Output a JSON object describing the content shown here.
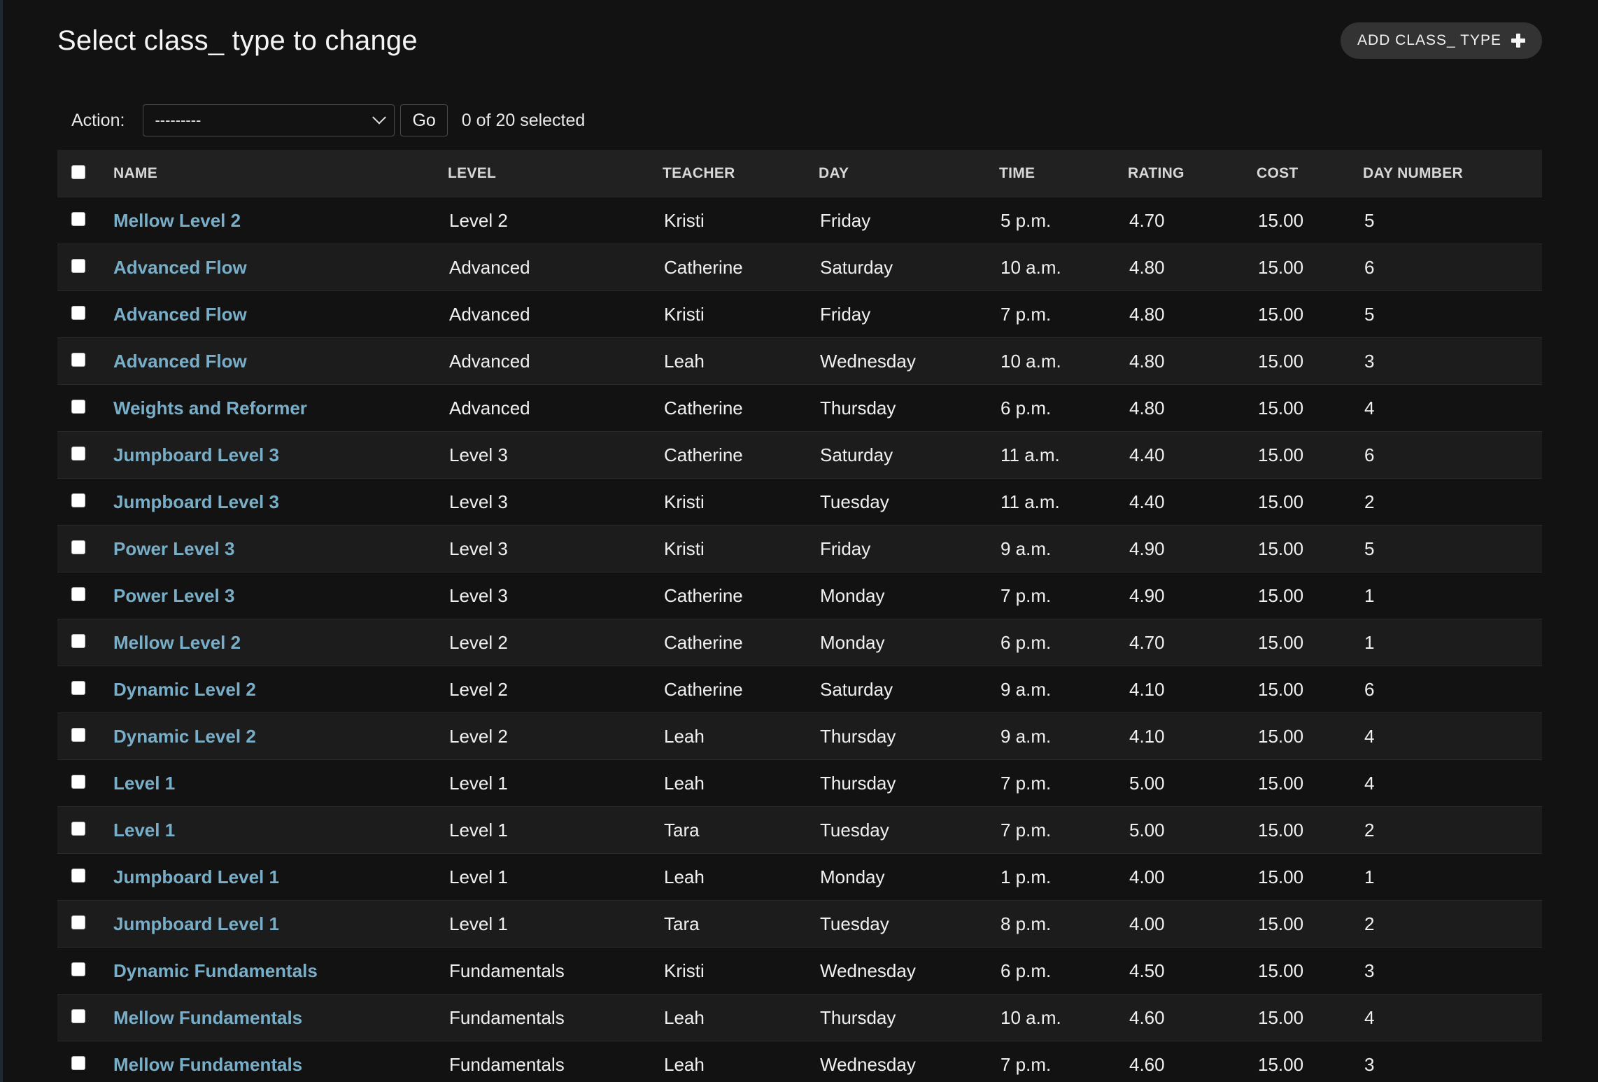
{
  "page": {
    "title": "Select class_ type to change",
    "add_button_label": "ADD CLASS_ TYPE"
  },
  "actions": {
    "label": "Action:",
    "select_value": "---------",
    "go_label": "Go",
    "selection_counter": "0 of 20 selected"
  },
  "table": {
    "columns": [
      "NAME",
      "LEVEL",
      "TEACHER",
      "DAY",
      "TIME",
      "RATING",
      "COST",
      "DAY NUMBER"
    ],
    "rows": [
      {
        "name": "Mellow Level 2",
        "level": "Level 2",
        "teacher": "Kristi",
        "day": "Friday",
        "time": "5 p.m.",
        "rating": "4.70",
        "cost": "15.00",
        "day_number": "5"
      },
      {
        "name": "Advanced Flow",
        "level": "Advanced",
        "teacher": "Catherine",
        "day": "Saturday",
        "time": "10 a.m.",
        "rating": "4.80",
        "cost": "15.00",
        "day_number": "6"
      },
      {
        "name": "Advanced Flow",
        "level": "Advanced",
        "teacher": "Kristi",
        "day": "Friday",
        "time": "7 p.m.",
        "rating": "4.80",
        "cost": "15.00",
        "day_number": "5"
      },
      {
        "name": "Advanced Flow",
        "level": "Advanced",
        "teacher": "Leah",
        "day": "Wednesday",
        "time": "10 a.m.",
        "rating": "4.80",
        "cost": "15.00",
        "day_number": "3"
      },
      {
        "name": "Weights and Reformer",
        "level": "Advanced",
        "teacher": "Catherine",
        "day": "Thursday",
        "time": "6 p.m.",
        "rating": "4.80",
        "cost": "15.00",
        "day_number": "4"
      },
      {
        "name": "Jumpboard Level 3",
        "level": "Level 3",
        "teacher": "Catherine",
        "day": "Saturday",
        "time": "11 a.m.",
        "rating": "4.40",
        "cost": "15.00",
        "day_number": "6"
      },
      {
        "name": "Jumpboard Level 3",
        "level": "Level 3",
        "teacher": "Kristi",
        "day": "Tuesday",
        "time": "11 a.m.",
        "rating": "4.40",
        "cost": "15.00",
        "day_number": "2"
      },
      {
        "name": "Power Level 3",
        "level": "Level 3",
        "teacher": "Kristi",
        "day": "Friday",
        "time": "9 a.m.",
        "rating": "4.90",
        "cost": "15.00",
        "day_number": "5"
      },
      {
        "name": "Power Level 3",
        "level": "Level 3",
        "teacher": "Catherine",
        "day": "Monday",
        "time": "7 p.m.",
        "rating": "4.90",
        "cost": "15.00",
        "day_number": "1"
      },
      {
        "name": "Mellow Level 2",
        "level": "Level 2",
        "teacher": "Catherine",
        "day": "Monday",
        "time": "6 p.m.",
        "rating": "4.70",
        "cost": "15.00",
        "day_number": "1"
      },
      {
        "name": "Dynamic Level 2",
        "level": "Level 2",
        "teacher": "Catherine",
        "day": "Saturday",
        "time": "9 a.m.",
        "rating": "4.10",
        "cost": "15.00",
        "day_number": "6"
      },
      {
        "name": "Dynamic Level 2",
        "level": "Level 2",
        "teacher": "Leah",
        "day": "Thursday",
        "time": "9 a.m.",
        "rating": "4.10",
        "cost": "15.00",
        "day_number": "4"
      },
      {
        "name": "Level 1",
        "level": "Level 1",
        "teacher": "Leah",
        "day": "Thursday",
        "time": "7 p.m.",
        "rating": "5.00",
        "cost": "15.00",
        "day_number": "4"
      },
      {
        "name": "Level 1",
        "level": "Level 1",
        "teacher": "Tara",
        "day": "Tuesday",
        "time": "7 p.m.",
        "rating": "5.00",
        "cost": "15.00",
        "day_number": "2"
      },
      {
        "name": "Jumpboard Level 1",
        "level": "Level 1",
        "teacher": "Leah",
        "day": "Monday",
        "time": "1 p.m.",
        "rating": "4.00",
        "cost": "15.00",
        "day_number": "1"
      },
      {
        "name": "Jumpboard Level 1",
        "level": "Level 1",
        "teacher": "Tara",
        "day": "Tuesday",
        "time": "8 p.m.",
        "rating": "4.00",
        "cost": "15.00",
        "day_number": "2"
      },
      {
        "name": "Dynamic Fundamentals",
        "level": "Fundamentals",
        "teacher": "Kristi",
        "day": "Wednesday",
        "time": "6 p.m.",
        "rating": "4.50",
        "cost": "15.00",
        "day_number": "3"
      },
      {
        "name": "Mellow Fundamentals",
        "level": "Fundamentals",
        "teacher": "Leah",
        "day": "Thursday",
        "time": "10 a.m.",
        "rating": "4.60",
        "cost": "15.00",
        "day_number": "4"
      },
      {
        "name": "Mellow Fundamentals",
        "level": "Fundamentals",
        "teacher": "Leah",
        "day": "Wednesday",
        "time": "7 p.m.",
        "rating": "4.60",
        "cost": "15.00",
        "day_number": "3"
      }
    ]
  }
}
